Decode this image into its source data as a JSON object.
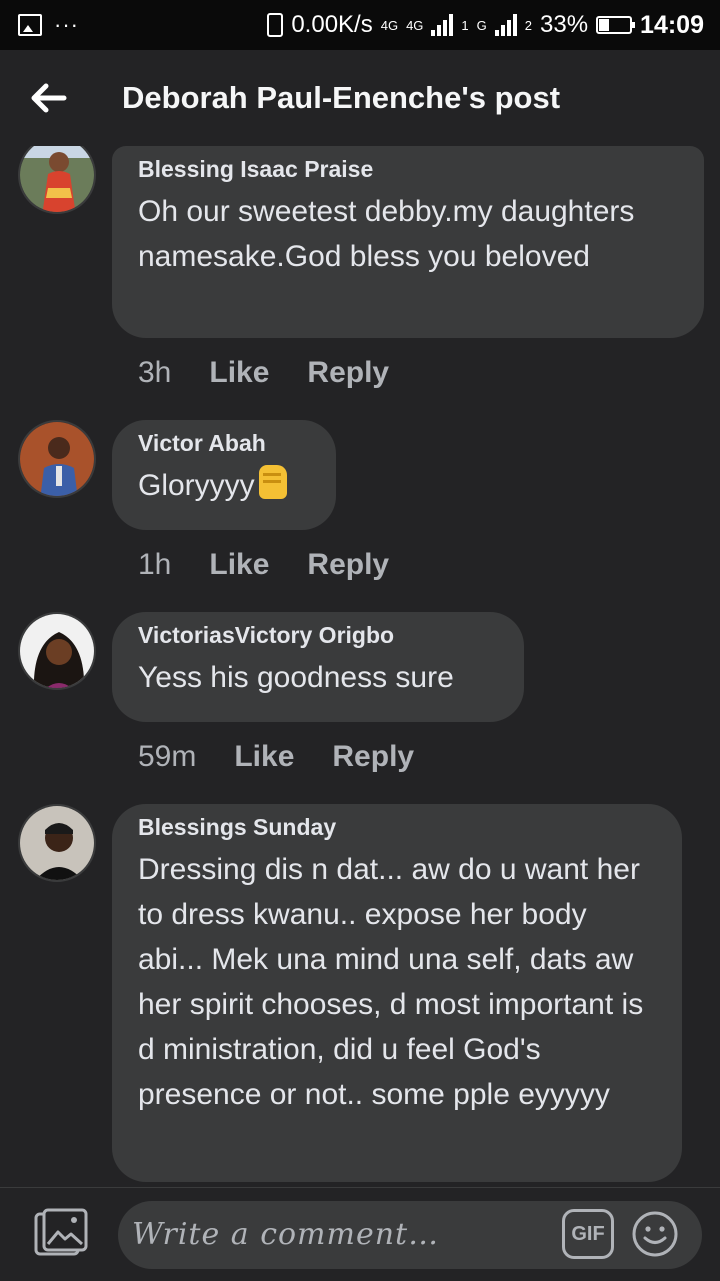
{
  "status_bar": {
    "net_speed": "0.00K/s",
    "net1": "4G",
    "net2": "4G",
    "net3": "G",
    "sim1": "1",
    "sim2": "2",
    "battery": "33%",
    "time": "14:09",
    "dots": "···"
  },
  "header": {
    "title": "Deborah Paul-Enenche's post"
  },
  "comments": [
    {
      "author": "Blessing Isaac Praise",
      "text": "Oh our sweetest debby.my daughters namesake.God bless you beloved",
      "time": "3h",
      "like": "Like",
      "reply": "Reply"
    },
    {
      "author": "Victor Abah",
      "text": "Gloryyyy",
      "time": "1h",
      "like": "Like",
      "reply": "Reply"
    },
    {
      "author": "VictoriasVictory Origbo",
      "text": "Yess his goodness sure",
      "time": "59m",
      "like": "Like",
      "reply": "Reply"
    },
    {
      "author": "Blessings Sunday",
      "text": "Dressing dis n dat... aw do u want her to dress kwanu.. expose her body abi... Mek una mind una self, dats aw her spirit chooses, d most important is d ministration, did u feel God's presence or not.. some pple eyyyyy"
    }
  ],
  "composer": {
    "placeholder": "Write a comment…",
    "gif_label": "GIF"
  },
  "icons": {
    "back": "arrow-left-icon",
    "photo": "photo-icon",
    "emoji": "smiley-icon",
    "gif": "gif-icon",
    "reaction_emoji": "raised-fist-icon"
  },
  "colors": {
    "background": "#232325",
    "bubble": "#3a3b3c",
    "text_primary": "#e4e6eb",
    "text_secondary": "#b0b3b8",
    "status_bar": "#0a0a0a"
  }
}
